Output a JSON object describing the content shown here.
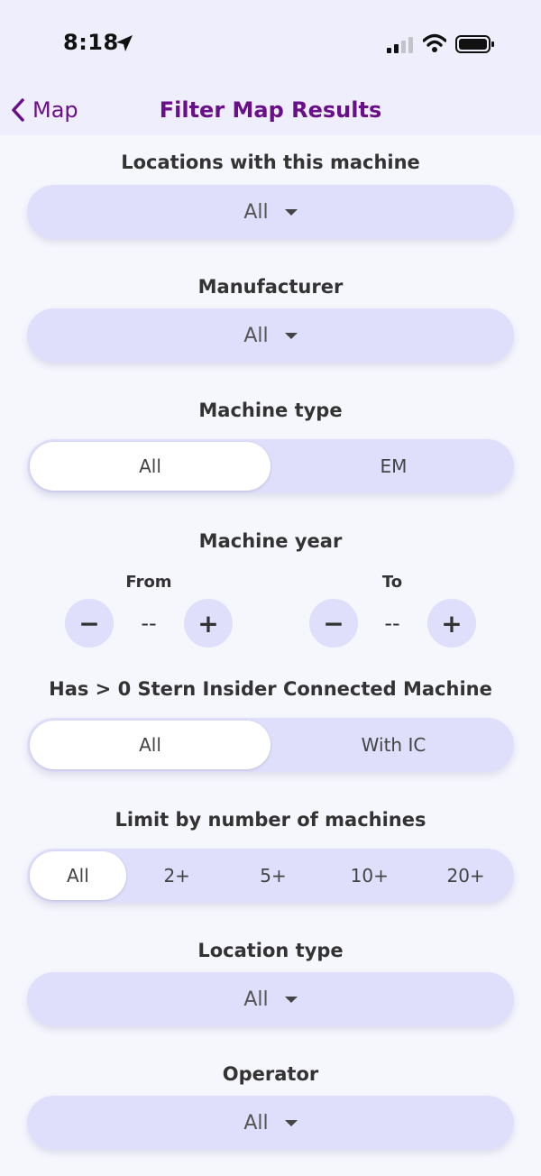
{
  "status_bar": {
    "time": "8:18"
  },
  "nav": {
    "back_label": "Map",
    "title": "Filter Map Results"
  },
  "sections": {
    "locations_machine": {
      "title": "Locations with this machine",
      "value": "All"
    },
    "manufacturer": {
      "title": "Manufacturer",
      "value": "All"
    },
    "machine_type": {
      "title": "Machine type",
      "options": [
        "All",
        "EM"
      ],
      "selected": "All"
    },
    "machine_year": {
      "title": "Machine year",
      "from_label": "From",
      "to_label": "To",
      "from_value": "--",
      "to_value": "--",
      "minus": "−",
      "plus": "+"
    },
    "stern_insider": {
      "title": "Has > 0 Stern Insider Connected Machine",
      "options": [
        "All",
        "With IC"
      ],
      "selected": "All"
    },
    "limit_count": {
      "title": "Limit by number of machines",
      "options": [
        "All",
        "2+",
        "5+",
        "10+",
        "20+"
      ],
      "selected": "All"
    },
    "location_type": {
      "title": "Location type",
      "value": "All"
    },
    "operator": {
      "title": "Operator",
      "value": "All"
    }
  },
  "colors": {
    "accent": "#6a0f8a",
    "control_bg": "#dfdffc",
    "page_bg": "#f6f6fd"
  }
}
